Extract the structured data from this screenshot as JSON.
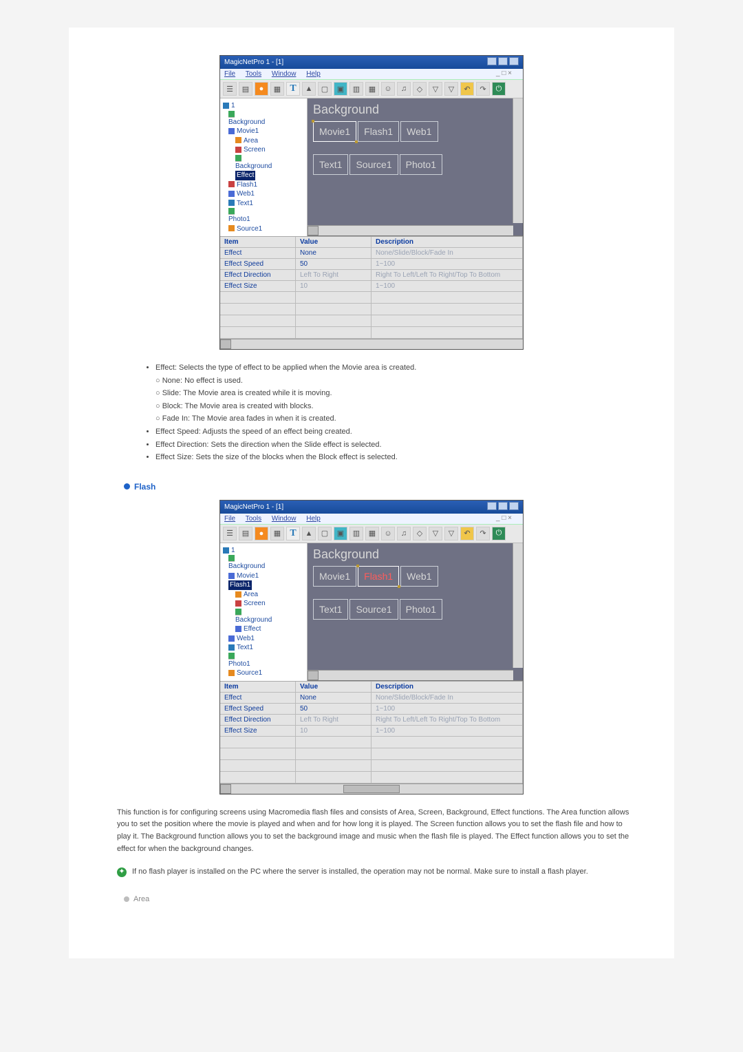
{
  "app": {
    "title": "MagicNetPro 1 - [1]"
  },
  "menu": [
    "File",
    "Tools",
    "Window",
    "Help",
    "_ □ ×"
  ],
  "tree": {
    "root": "1",
    "items": [
      "Background",
      "Movie1",
      "Area",
      "Screen",
      "Background",
      "Effect",
      "Flash1",
      "Web1",
      "Text1",
      "Photo1",
      "Source1"
    ]
  },
  "canvas": {
    "bg": "Background",
    "row1": [
      "Movie1",
      "Flash1",
      "Web1"
    ],
    "row2": [
      "Text1",
      "Source1",
      "Photo1"
    ]
  },
  "grid": {
    "head": [
      "Item",
      "Value",
      "Description"
    ],
    "rows": [
      {
        "i": "Effect",
        "v": "None",
        "d": "None/Slide/Block/Fade In"
      },
      {
        "i": "Effect Speed",
        "v": "50",
        "d": "1~100"
      },
      {
        "i": "Effect Direction",
        "v": "Left To Right",
        "d": "Right To Left/Left To Right/Top To Bottom"
      },
      {
        "i": "Effect Size",
        "v": "10",
        "d": "1~100"
      }
    ]
  },
  "bullets": {
    "effect": "Effect: Selects the type of effect to be applied when the Movie area is created.",
    "sub": [
      "None: No effect is used.",
      "Slide: The Movie area is created while it is moving.",
      "Block: The Movie area is created with blocks.",
      "Fade In: The Movie area fades in when it is created."
    ],
    "speed": "Effect Speed: Adjusts the speed of an effect being created.",
    "dir": "Effect Direction: Sets the direction when the Slide effect is selected.",
    "size": "Effect Size: Sets the size of the blocks when the Block effect is selected."
  },
  "flash": {
    "heading": "Flash",
    "para": "This function is for configuring screens using Macromedia flash files and consists of Area, Screen, Background, Effect functions. The Area function allows you to set the position where the movie is played and when and for how long it is played. The Screen function allows you to set the flash file and how to play it. The Background function allows you to set the background image and music when the flash file is played. The Effect function allows you to set the effect for when the background changes.",
    "note": "If no flash player is installed on the PC where the server is installed, the operation may not be normal. Make sure to install a flash player.",
    "sub": "Area"
  }
}
